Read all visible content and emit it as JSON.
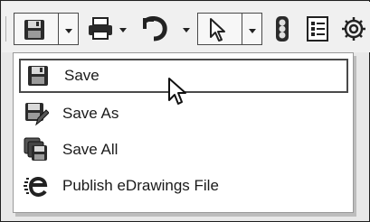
{
  "toolbar": {
    "buttons": [
      {
        "name": "save-split-button",
        "icon": "save-icon"
      },
      {
        "name": "print-split-button",
        "icon": "printer-icon"
      },
      {
        "name": "undo-split-button",
        "icon": "undo-icon"
      },
      {
        "name": "select-split-button",
        "icon": "cursor-icon"
      },
      {
        "name": "traffic-light-button",
        "icon": "traffic-light-icon"
      },
      {
        "name": "options-list-button",
        "icon": "list-icon"
      },
      {
        "name": "settings-button",
        "icon": "gear-icon"
      }
    ]
  },
  "menu": {
    "items": [
      {
        "label": "Save",
        "icon": "save-icon",
        "highlighted": true
      },
      {
        "label": "Save As",
        "icon": "save-as-icon",
        "highlighted": false
      },
      {
        "label": "Save All",
        "icon": "save-all-icon",
        "highlighted": false
      },
      {
        "label": "Publish eDrawings File",
        "icon": "edrawings-icon",
        "highlighted": false
      }
    ]
  }
}
